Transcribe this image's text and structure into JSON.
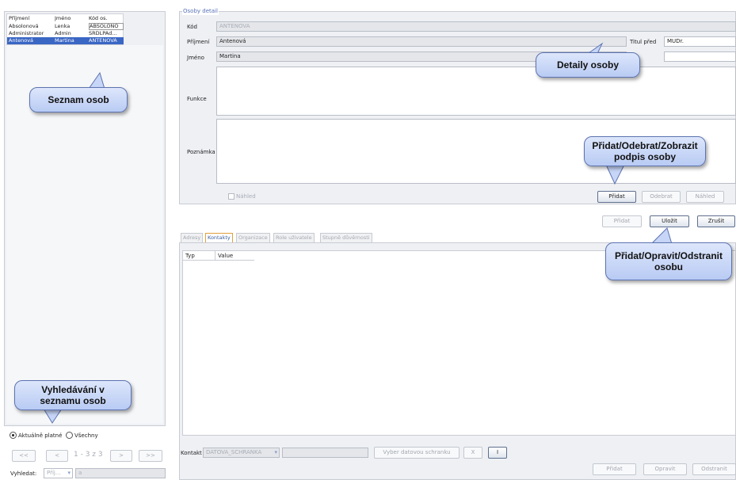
{
  "person_list": {
    "columns": [
      "Příjmení",
      "Jméno",
      "Kód os."
    ],
    "rows": [
      {
        "surname": "Absolonová",
        "name": "Lenka",
        "code": "ABSOLONO",
        "selected": false
      },
      {
        "surname": "Administrator",
        "name": "Admin",
        "code": "SRDLPAd...",
        "selected": false
      },
      {
        "surname": "Antenová",
        "name": "Martina",
        "code": "ANTENOVA",
        "selected": true
      }
    ],
    "filter_active": "Aktuálně platné",
    "filter_all": "Všechny",
    "pager": {
      "first": "<<",
      "prev": "<",
      "info": "1 - 3 z 3",
      "next": ">",
      "last": ">>"
    },
    "search_label": "Vyhledat:",
    "search_field": "Příj...",
    "search_value": "a"
  },
  "detail": {
    "legend": "Osoby detail",
    "code_label": "Kód",
    "code_value": "ANTENOVA",
    "surname_label": "Příjmení",
    "surname_value": "Antenová",
    "title_before_label": "Titul před",
    "title_before_value": "MUDr.",
    "name_label": "Jméno",
    "name_value": "Martina",
    "title_after_value": "",
    "function_label": "Funkce",
    "note_label": "Poznámka",
    "preview_checkbox": "Náhled",
    "signature_buttons": {
      "add": "Přidat",
      "remove": "Odebrat",
      "view": "Náhled"
    },
    "form_buttons": {
      "add": "Přidat",
      "save": "Uložit",
      "cancel": "Zrušit"
    }
  },
  "tabs": [
    "Adresy",
    "Kontakty",
    "Organizace",
    "Role uživatele",
    "Stupně důvěrnosti"
  ],
  "selected_tab": "Kontakty",
  "contacts_table": {
    "columns": [
      "Typ",
      "Value"
    ]
  },
  "contact_bar": {
    "label": "Kontakt",
    "type_value": "DATOVA_SCHRANKA",
    "value": "",
    "choose_button": "Vyber datovou schranku",
    "x_button": "X",
    "i_button": "I"
  },
  "contact_buttons": {
    "add": "Přidat",
    "edit": "Opravit",
    "delete": "Odstranit"
  },
  "callouts": {
    "list": "Seznam osob",
    "details": "Detaily osoby",
    "signature": "Přidat/Odebrat/Zobrazit podpis osoby",
    "save": "Přidat/Opravit/Odstranit osobu",
    "search": "Vyhledávání v seznamu osob"
  },
  "colors": {
    "selection": "#3a66c4",
    "callout_fill": "#c7d5f7",
    "callout_border": "#5c73b0",
    "tab_highlight": "#e0a03c"
  }
}
